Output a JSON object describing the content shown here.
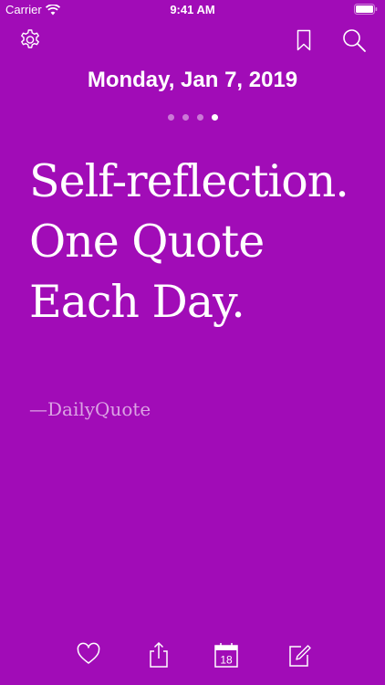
{
  "status_bar": {
    "carrier": "Carrier",
    "time": "9:41 AM"
  },
  "header": {
    "date": "Monday, Jan 7, 2019"
  },
  "pagination": {
    "total": 4,
    "active_index": 3
  },
  "quote": {
    "text": "Self-reflection. One Quote Each Day.",
    "author": "—DailyQuote"
  },
  "toolbar": {
    "settings_icon": "gear-icon",
    "bookmark_icon": "bookmark-icon",
    "search_icon": "search-icon"
  },
  "bottom_bar": {
    "favorite_icon": "heart-icon",
    "share_icon": "share-icon",
    "calendar_icon": "calendar-icon",
    "calendar_day": "18",
    "compose_icon": "compose-icon"
  },
  "colors": {
    "background": "#a10cb7",
    "text": "#ffffff"
  }
}
